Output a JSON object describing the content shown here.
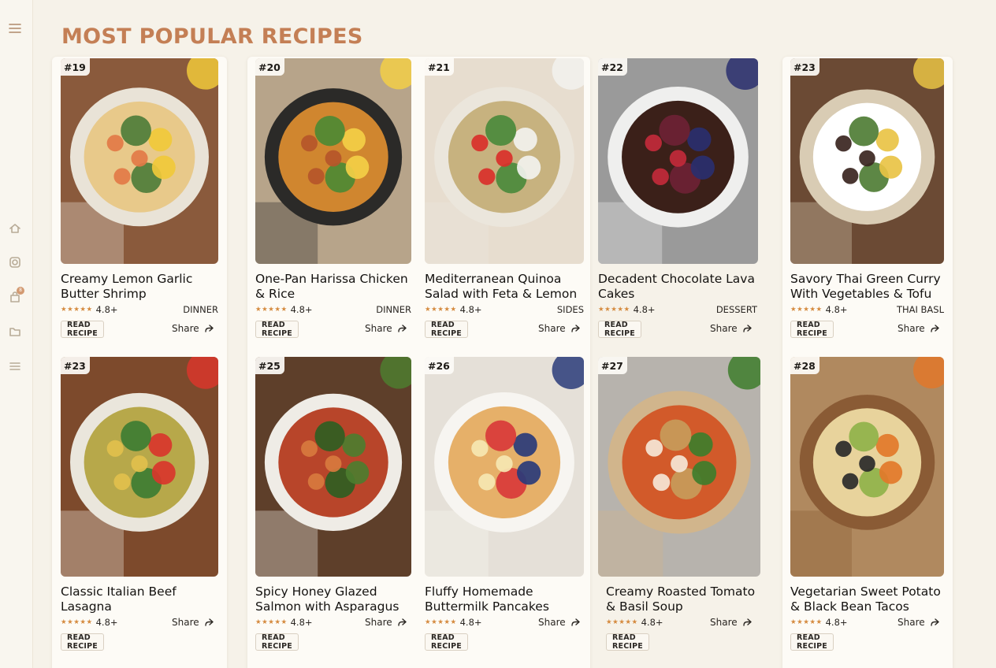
{
  "page": {
    "title": "MOST POPULAR RECIPES"
  },
  "sidebar": {
    "items": [
      "menu-icon",
      "home-icon",
      "instagram-icon",
      "bag-icon",
      "folder-icon",
      "list-icon"
    ],
    "badge": "8"
  },
  "labels": {
    "read_recipe": "READ RECIPE",
    "share": "Share"
  },
  "recipes": [
    {
      "rank": "#19",
      "title_line1": "Creamy Lemon Garlic",
      "title_line2": "Butter Shrimp",
      "rating": "4.8+",
      "category": "DINNER",
      "stars": "★★★★★"
    },
    {
      "rank": "#20",
      "title_line1": "One-Pan Harissa Chicken",
      "title_line2": "& Rice",
      "rating": "4.8+",
      "category": "DINNER",
      "stars": "★★★★★"
    },
    {
      "rank": "#21",
      "title_line1": "Mediterranean Quinoa",
      "title_line2": "Salad with Feta & Lemon",
      "rating": "4.8+",
      "category": "SIDES",
      "stars": "★★★★★"
    },
    {
      "rank": "#22",
      "title_line1": "Decadent Chocolate Lava",
      "title_line2": "Cakes",
      "rating": "4.8+",
      "category": "DESSERT",
      "stars": "★★★★★"
    },
    {
      "rank": "#23",
      "title_line1": "Savory Thai Green Curry",
      "title_line2": "With Vegetables & Tofu",
      "rating": "4.8+",
      "category": "THAI BASL",
      "stars": "★★★★★"
    },
    {
      "rank": "#23",
      "title_line1": "Classic Italian Beef",
      "title_line2": "Lasagna",
      "rating": "4.8+",
      "category": "",
      "stars": "★★★★★"
    },
    {
      "rank": "#25",
      "title_line1": "Spicy Honey Glazed",
      "title_line2": "Salmon with Asparagus",
      "rating": "4.8+",
      "category": "",
      "stars": "★★★★★"
    },
    {
      "rank": "#26",
      "title_line1": "Fluffy Homemade",
      "title_line2": "Buttermilk Pancakes",
      "rating": "4.8+",
      "category": "",
      "stars": "★★★★★"
    },
    {
      "rank": "#27",
      "title_line1": "Creamy Roasted Tomato",
      "title_line2": "& Basil Soup",
      "rating": "4.8+",
      "category": "",
      "stars": "★★★★★"
    },
    {
      "rank": "#28",
      "title_line1": "Vegetarian Sweet Potato",
      "title_line2": "& Black Bean Tacos",
      "rating": "4.8+",
      "category": "",
      "stars": "★★★★★"
    }
  ]
}
